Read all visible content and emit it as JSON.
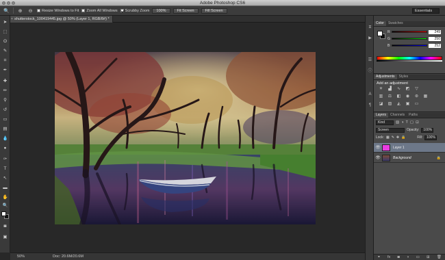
{
  "app": {
    "title": "Adobe Photoshop CS6"
  },
  "options": {
    "resize_label": "Resize Windows to Fit",
    "zoom_all_label": "Zoom All Windows",
    "scrubby_label": "Scrubby Zoom",
    "btn_100": "100%",
    "btn_fit": "Fit Screen",
    "btn_fill": "Fill Screen",
    "workspace": "Essentials"
  },
  "document": {
    "tab_label": "shutterstock_100419445.jpg @ 50% (Layer 1, RGB/8#) *",
    "close_glyph": "×"
  },
  "status": {
    "zoom": "50%",
    "doc": "Doc: 20.6M/20.6M"
  },
  "color_panel": {
    "tabs": [
      "Color",
      "Swatches"
    ],
    "channels": [
      {
        "label": "R",
        "value": "249",
        "gradient": "linear-gradient(to right, #000, #f00)"
      },
      {
        "label": "G",
        "value": "250",
        "gradient": "linear-gradient(to right, #000, #0f0)"
      },
      {
        "label": "B",
        "value": "252",
        "gradient": "linear-gradient(to right, #000, #00f)"
      }
    ]
  },
  "adjustments_panel": {
    "tabs": [
      "Adjustments",
      "Styles"
    ],
    "heading": "Add an adjustment"
  },
  "layers_panel": {
    "tabs": [
      "Layers",
      "Channels",
      "Paths"
    ],
    "filter_kind": "Kind",
    "blend_mode": "Screen",
    "opacity_label": "Opacity:",
    "opacity_value": "100%",
    "lock_label": "Lock:",
    "fill_label": "Fill:",
    "fill_value": "100%",
    "layers": [
      {
        "name": "Layer 1",
        "selected": true,
        "thumb_color": "#e83ce0"
      },
      {
        "name": "Background",
        "selected": false,
        "thumb_color": "#3a3344"
      }
    ]
  },
  "colors": {
    "accent_selection": "#6d7889",
    "layer1_fill": "#e83ce0"
  }
}
